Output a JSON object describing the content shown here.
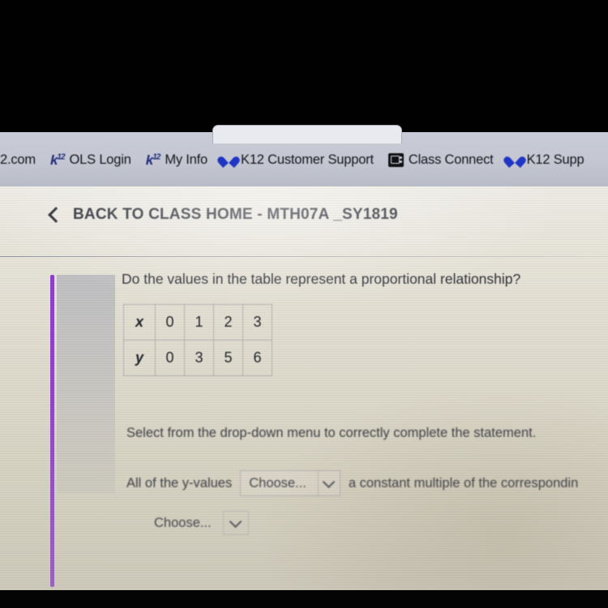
{
  "browser": {
    "bookmarks": [
      {
        "label": "2.com",
        "icon": "none"
      },
      {
        "label": "OLS Login",
        "icon": "k12-logo-icon"
      },
      {
        "label": "My Info",
        "icon": "k12-logo-icon"
      },
      {
        "label": "K12 Customer Support",
        "icon": "heart-icon"
      },
      {
        "label": "Class Connect",
        "icon": "screen-icon"
      },
      {
        "label": "K12 Supp",
        "icon": "heart-icon"
      }
    ],
    "k12_logo_text": "k",
    "k12_logo_sup": "12"
  },
  "header": {
    "back_label": "BACK TO CLASS HOME - MTH07A _SY1819",
    "back_icon": "chevron-left-icon"
  },
  "content": {
    "question": "Do the values in the table represent a proportional relationship?",
    "table": {
      "rows": [
        {
          "name": "x",
          "values": [
            "0",
            "1",
            "2",
            "3"
          ]
        },
        {
          "name": "y",
          "values": [
            "0",
            "3",
            "5",
            "6"
          ]
        }
      ]
    },
    "instruction": "Select from the drop-down menu to correctly complete the statement.",
    "statement": {
      "prefix": "All of the y-values",
      "dropdown_1": "Choose...",
      "suffix": "a constant multiple of the correspondin",
      "dropdown_2": "Choose..."
    },
    "accent_color": "#8b3fc9"
  }
}
